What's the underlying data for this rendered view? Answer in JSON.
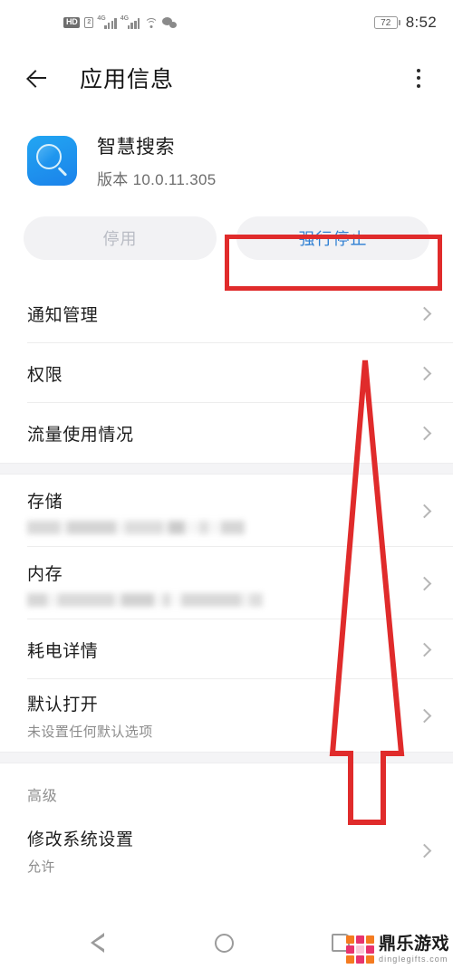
{
  "statusbar": {
    "hd_label": "HD",
    "sim_label": "2",
    "network_label_1": "4G",
    "network_label_2": "4G",
    "wifi_icon": "wifi-icon",
    "wechat_icon": "wechat-icon",
    "battery_level": "72",
    "time": "8:52"
  },
  "appbar": {
    "back_icon": "back-arrow-icon",
    "title": "应用信息",
    "overflow_icon": "overflow-menu-icon"
  },
  "app": {
    "icon_name": "search-app-icon",
    "name": "智慧搜索",
    "version": "版本 10.0.11.305"
  },
  "actions": {
    "disable_label": "停用",
    "force_stop_label": "强行停止",
    "disable_color": "#b9bcc4",
    "force_stop_color": "#2d7fd3"
  },
  "groups": [
    {
      "items": [
        {
          "label": "通知管理",
          "sub": "",
          "redacted": false
        },
        {
          "label": "权限",
          "sub": "",
          "redacted": false
        },
        {
          "label": "流量使用情况",
          "sub": "",
          "redacted": false
        }
      ]
    },
    {
      "items": [
        {
          "label": "存储",
          "sub": "",
          "redacted": true
        },
        {
          "label": "内存",
          "sub": "",
          "redacted": true
        },
        {
          "label": "耗电详情",
          "sub": "",
          "redacted": false
        },
        {
          "label": "默认打开",
          "sub": "未设置任何默认选项",
          "redacted": false
        }
      ]
    },
    {
      "header": "高级",
      "items": [
        {
          "label": "修改系统设置",
          "sub": "允许",
          "redacted": false
        }
      ]
    }
  ],
  "annotations": {
    "highlight_color": "#e02b2b",
    "rect_target": "force-stop-button",
    "arrow_direction": "up"
  },
  "navbar": {
    "back_icon": "nav-back-icon",
    "home_icon": "nav-home-icon",
    "recents_icon": "nav-recents-icon"
  },
  "watermark": {
    "name_cn": "鼎乐游戏",
    "name_en": "dinglegifts.com",
    "color_orange": "#f47b20",
    "color_pink": "#e8336e"
  }
}
